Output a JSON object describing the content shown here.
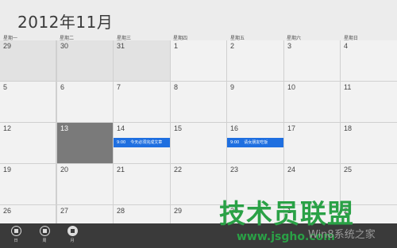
{
  "calendar": {
    "title": "2012年11月",
    "weekdays": [
      "星期一",
      "星期二",
      "星期三",
      "星期四",
      "星期五",
      "星期六",
      "星期日"
    ],
    "rows": [
      [
        "29",
        "30",
        "31",
        "1",
        "2",
        "3",
        "4"
      ],
      [
        "5",
        "6",
        "7",
        "8",
        "9",
        "10",
        "11"
      ],
      [
        "12",
        "13",
        "14",
        "15",
        "16",
        "17",
        "18"
      ],
      [
        "19",
        "20",
        "21",
        "22",
        "23",
        "24",
        "25"
      ],
      [
        "26",
        "27",
        "28",
        "29",
        "30",
        "1",
        "2"
      ]
    ],
    "other_month_cells": [
      "r0c0",
      "r0c1",
      "r0c2"
    ],
    "today_cell": "r2c1",
    "events": [
      {
        "day": "14",
        "time": "9:00",
        "title": "今天必须完成文章"
      },
      {
        "day": "16",
        "time": "9:00",
        "title": "请女朋友吃饭"
      }
    ]
  },
  "appbar": {
    "buttons": [
      {
        "label": "日",
        "icon": "day-view-icon"
      },
      {
        "label": "周",
        "icon": "week-view-icon"
      },
      {
        "label": "月",
        "icon": "month-view-icon"
      }
    ]
  },
  "watermark": {
    "logo_text": "技术员联盟",
    "url": "www.jsgho.com",
    "sub": "Win8系统之家"
  },
  "colors": {
    "background": "#ececec",
    "today_bg": "#7a7a7a",
    "event_bg": "#1f6fe0",
    "appbar_bg": "#3a3a3a"
  }
}
